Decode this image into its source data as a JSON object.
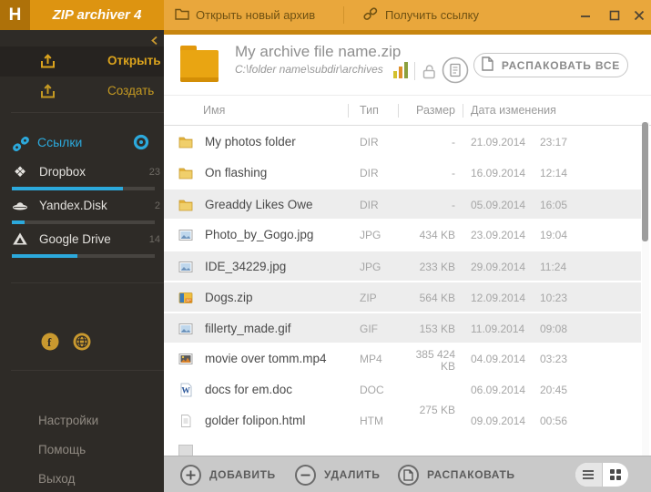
{
  "window": {
    "logo": "H",
    "title": "ZIP archiver 4"
  },
  "topbar": {
    "open_new_archive": "Открыть новый архив",
    "get_link": "Получить ссылку"
  },
  "sidebar": {
    "items": {
      "open": "Открыть",
      "create": "Создать"
    },
    "links_label": "Ссылки",
    "clouds": [
      {
        "name": "Dropbox",
        "count": "23",
        "percent": 78,
        "icon": "dropbox"
      },
      {
        "name": "Yandex.Disk",
        "count": "2",
        "percent": 9,
        "icon": "yandex-disk"
      },
      {
        "name": "Google Drive",
        "count": "14",
        "percent": 46,
        "icon": "google-drive"
      }
    ],
    "footer": {
      "settings": "Настройки",
      "help": "Помощь",
      "exit": "Выход"
    }
  },
  "archive": {
    "name": "My archive file name.zip",
    "path": "C:\\folder name\\subdir\\archives",
    "extract_all_label": "РАСПАКОВАТЬ ВСЕ"
  },
  "table": {
    "columns": {
      "name": "Имя",
      "type": "Тип",
      "size": "Размер",
      "modified": "Дата изменения"
    }
  },
  "files": [
    {
      "name": "My photos folder",
      "type": "DIR",
      "size": "-",
      "date": "21.09.2014",
      "time": "23:17",
      "icon": "folder",
      "shade": false
    },
    {
      "name": "On flashing",
      "type": "DIR",
      "size": "-",
      "date": "16.09.2014",
      "time": "12:14",
      "icon": "folder",
      "shade": false
    },
    {
      "name": "Greaddy Likes Owe",
      "type": "DIR",
      "size": "-",
      "date": "05.09.2014",
      "time": "16:05",
      "icon": "folder",
      "shade": true
    },
    {
      "name": "Photo_by_Gogo.jpg",
      "type": "JPG",
      "size": "434 KB",
      "date": "23.09.2014",
      "time": "19:04",
      "icon": "image",
      "shade": false
    },
    {
      "name": "IDE_34229.jpg",
      "type": "JPG",
      "size": "233 KB",
      "date": "29.09.2014",
      "time": "11:24",
      "icon": "image",
      "shade": true
    },
    {
      "name": "Dogs.zip",
      "type": "ZIP",
      "size": "564 KB",
      "date": "12.09.2014",
      "time": "10:23",
      "icon": "zip",
      "shade": true
    },
    {
      "name": "fillerty_made.gif",
      "type": "GIF",
      "size": "153 KB",
      "date": "11.09.2014",
      "time": "09:08",
      "icon": "image",
      "shade": true
    },
    {
      "name": "movie over tomm.mp4",
      "type": "MP4",
      "size": "385 424 KB",
      "date": "04.09.2014",
      "time": "03:23",
      "icon": "video",
      "shade": false,
      "size_wrap": true
    },
    {
      "name": "docs for em.doc",
      "type": "DOC",
      "size": "",
      "date": "06.09.2014",
      "time": "20:45",
      "icon": "doc",
      "shade": false
    },
    {
      "name": "golder folipon.html",
      "type": "HTM",
      "size": "275 KB",
      "date": "09.09.2014",
      "time": "00:56",
      "icon": "html",
      "shade": false,
      "size_raised": true
    }
  ],
  "bottombar": {
    "add": "ДОБАВИТЬ",
    "remove": "УДАЛИТЬ",
    "extract": "РАСПАКОВАТЬ"
  },
  "colors": {
    "topbar": "#E9A73C",
    "title_strip": "#DD9411",
    "logo_tile": "#AE7109",
    "sidebar_bg": "#2E2B27",
    "amber_accent": "#D49C1C",
    "cyan_accent": "#2CA9DC",
    "shade_row": "#EDEDED",
    "bottombar": "#C9C9C9"
  }
}
